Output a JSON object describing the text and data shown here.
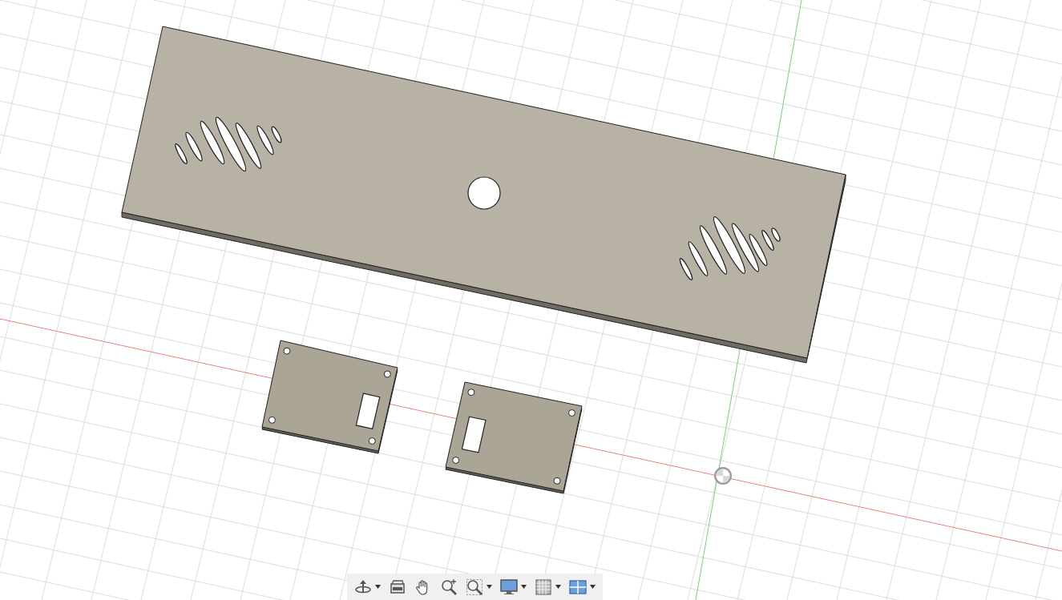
{
  "viewport": {
    "bodies": [
      {
        "kind": "speaker-panel"
      },
      {
        "kind": "right-slot-plate"
      },
      {
        "kind": "left-slot-plate"
      }
    ]
  },
  "toolbar": {
    "tools": [
      {
        "kind": "orbit",
        "menu": true
      },
      {
        "kind": "look-at",
        "menu": false
      },
      {
        "kind": "pan",
        "menu": false
      },
      {
        "kind": "zoom",
        "menu": false
      },
      {
        "kind": "fit",
        "menu": true
      },
      {
        "kind": "display",
        "menu": true
      },
      {
        "kind": "grid",
        "menu": true
      },
      {
        "kind": "viewports",
        "menu": true
      }
    ]
  }
}
